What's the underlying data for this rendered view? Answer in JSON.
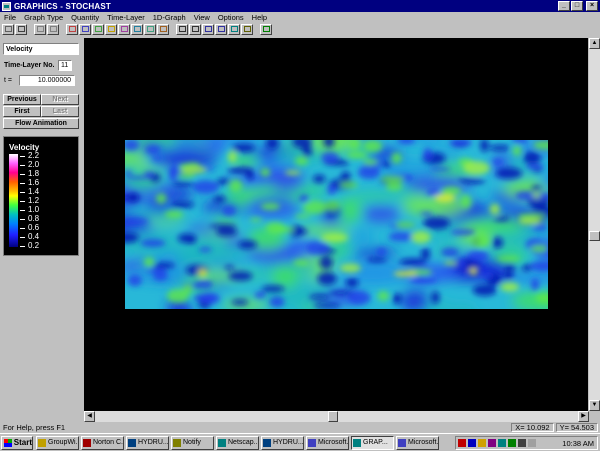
{
  "window": {
    "title": "GRAPHICS - STOCHAST"
  },
  "menu": [
    "File",
    "Graph Type",
    "Quantity",
    "Time-Layer",
    "1D-Graph",
    "View",
    "Options",
    "Help"
  ],
  "toolbar_icons": [
    "copy-icon",
    "print-icon",
    "grid-icon",
    "grid-dense-icon",
    "text-tool-icon",
    "arrow-tool-icon",
    "shape-tool-icon",
    "palette-icon",
    "line-tool-icon",
    "image-icon",
    "image-alt-icon",
    "export-icon",
    "fit-icon",
    "pan-icon",
    "zoom-icon",
    "zoom-in-icon",
    "rotate-icon",
    "pen-icon",
    "help-icon"
  ],
  "panel": {
    "quantity": "Velocity",
    "time_layer_label": "Time-Layer No.",
    "time_layer_value": "11",
    "t_label": "t =",
    "t_value": "10.000000",
    "previous": "Previous",
    "next": "Next",
    "first": "First",
    "last": "Last",
    "flow_animation": "Flow Animation"
  },
  "legend": {
    "title": "Velocity",
    "values": [
      "2.2",
      "2.0",
      "1.8",
      "1.6",
      "1.4",
      "1.2",
      "1.0",
      "0.8",
      "0.6",
      "0.4",
      "0.2"
    ]
  },
  "status": {
    "help_text": "For Help, press F1",
    "x": "X= 10.092",
    "y": "Y= 54.503"
  },
  "taskbar": {
    "start": "Start",
    "tasks": [
      {
        "label": "GroupWi...",
        "active": false
      },
      {
        "label": "Norton C...",
        "active": false
      },
      {
        "label": "HYDRU...",
        "active": false
      },
      {
        "label": "Notify",
        "active": false
      },
      {
        "label": "Netscap...",
        "active": false
      },
      {
        "label": "HYDRU...",
        "active": false
      },
      {
        "label": "Microsoft...",
        "active": false
      },
      {
        "label": "GRAP...",
        "active": true
      },
      {
        "label": "Microsoft...",
        "active": false
      }
    ],
    "clock": "10:38 AM"
  },
  "colors": {
    "titlebar": "#000080",
    "window": "#c0c0c0",
    "graph_bg": "#000000"
  }
}
